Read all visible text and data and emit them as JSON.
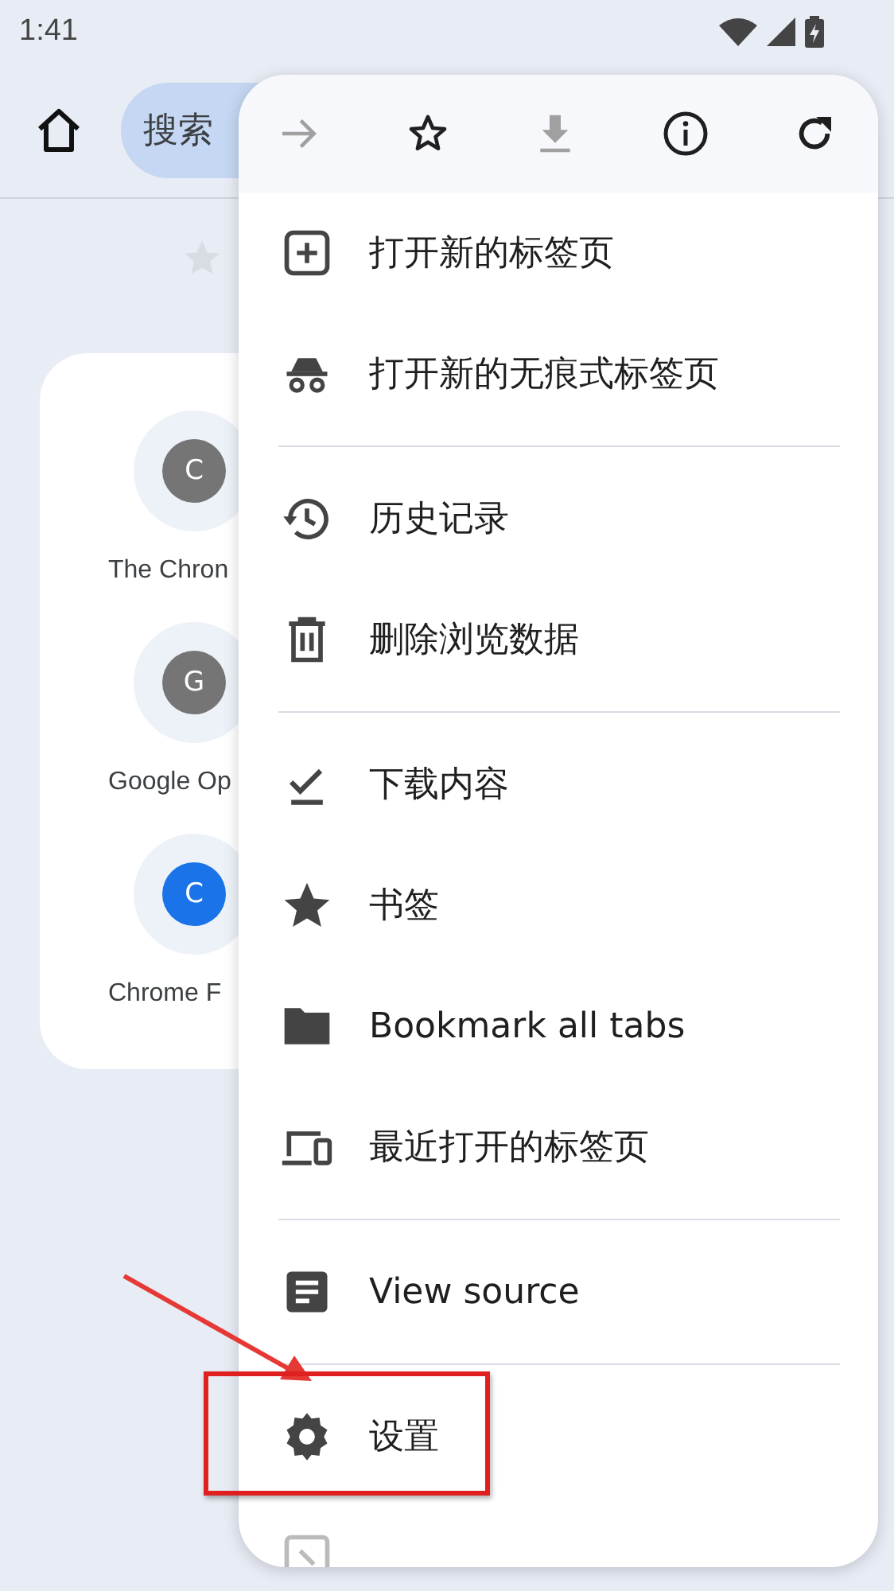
{
  "status_bar": {
    "time": "1:41"
  },
  "toolbar": {
    "search": {
      "placeholder": "搜索"
    }
  },
  "shortcuts": [
    {
      "letter": "C",
      "label": "The Chron",
      "color": "#757575"
    },
    {
      "letter": "G",
      "label": "Google Op",
      "color": "#757575"
    },
    {
      "letter": "C",
      "label": "Chrome F",
      "color": "#1a73e8"
    }
  ],
  "menu": {
    "toolbar": [
      {
        "kind": "forward",
        "disabled": true
      },
      {
        "kind": "bookmark",
        "disabled": false
      },
      {
        "kind": "download",
        "disabled": true
      },
      {
        "kind": "info",
        "disabled": false
      },
      {
        "kind": "reload",
        "disabled": false
      }
    ],
    "sections": [
      {
        "items": [
          {
            "kind": "new-tab",
            "label": "打开新的标签页"
          },
          {
            "kind": "incognito",
            "label": "打开新的无痕式标签页"
          }
        ]
      },
      {
        "items": [
          {
            "kind": "history",
            "label": "历史记录"
          },
          {
            "kind": "trash",
            "label": "删除浏览数据"
          }
        ]
      },
      {
        "items": [
          {
            "kind": "downloads",
            "label": "下载内容"
          },
          {
            "kind": "star",
            "label": "书签"
          },
          {
            "kind": "folder",
            "label": "Bookmark all tabs"
          },
          {
            "kind": "devices",
            "label": "最近打开的标签页"
          }
        ]
      },
      {
        "items": [
          {
            "kind": "source",
            "label": "View source"
          }
        ]
      },
      {
        "items": [
          {
            "kind": "settings",
            "label": "设置"
          },
          {
            "kind": "exit"
          }
        ]
      }
    ]
  }
}
